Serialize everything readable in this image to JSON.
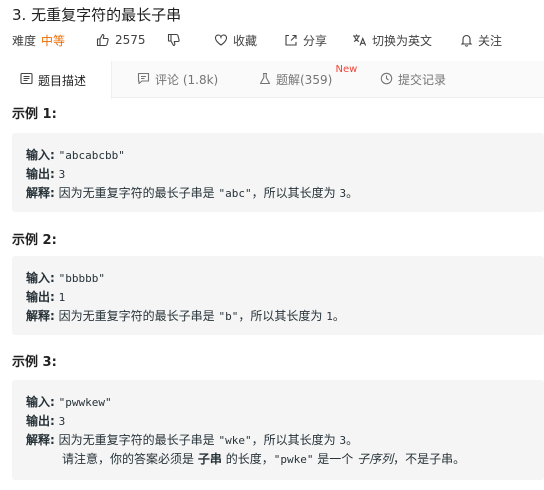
{
  "problem": {
    "title": "3. 无重复字符的最长子串"
  },
  "meta": {
    "difficulty_label": "难度",
    "difficulty_value": "中等",
    "likes": "2575",
    "favorite_label": "收藏",
    "share_label": "分享",
    "switch_lang_label": "切换为英文",
    "follow_label": "关注",
    "difficulty_color": "#ef6c00"
  },
  "tabs": [
    {
      "label": "题目描述",
      "icon": "description-icon",
      "active": true
    },
    {
      "label": "评论 (1.8k)",
      "icon": "comment-icon",
      "active": false
    },
    {
      "label": "题解(359)",
      "icon": "flask-icon",
      "active": false,
      "badge": "New"
    },
    {
      "label": "提交记录",
      "icon": "clock-icon",
      "active": false
    }
  ],
  "examples": [
    {
      "title": "示例 1:",
      "input_label": "输入:",
      "input_value": "\"abcabcbb\"",
      "output_label": "输出:",
      "output_value": "3",
      "explain_label": "解释:",
      "explain_prefix": "因为无重复字符的最长子串是",
      "explain_code": "\"abc\"",
      "explain_mid": "，所以其长度为",
      "explain_num": "3",
      "explain_end": "。"
    },
    {
      "title": "示例 2:",
      "input_label": "输入:",
      "input_value": "\"bbbbb\"",
      "output_label": "输出:",
      "output_value": "1",
      "explain_label": "解释:",
      "explain_prefix": "因为无重复字符的最长子串是",
      "explain_code": "\"b\"",
      "explain_mid": "，所以其长度为",
      "explain_num": "1",
      "explain_end": "。"
    },
    {
      "title": "示例 3:",
      "input_label": "输入:",
      "input_value": "\"pwwkew\"",
      "output_label": "输出:",
      "output_value": "3",
      "explain_label": "解释:",
      "explain_prefix": "因为无重复字符的最长子串是",
      "explain_code": "\"wke\"",
      "explain_mid": "，所以其长度为",
      "explain_num": "3",
      "explain_end": "。",
      "note_a": "请注意，你的答案必须是",
      "note_bold": "子串",
      "note_b": "的长度，",
      "note_code": "\"pwke\"",
      "note_c": "是一个",
      "note_italic": "子序列",
      "note_d": "，不是子串。"
    }
  ]
}
